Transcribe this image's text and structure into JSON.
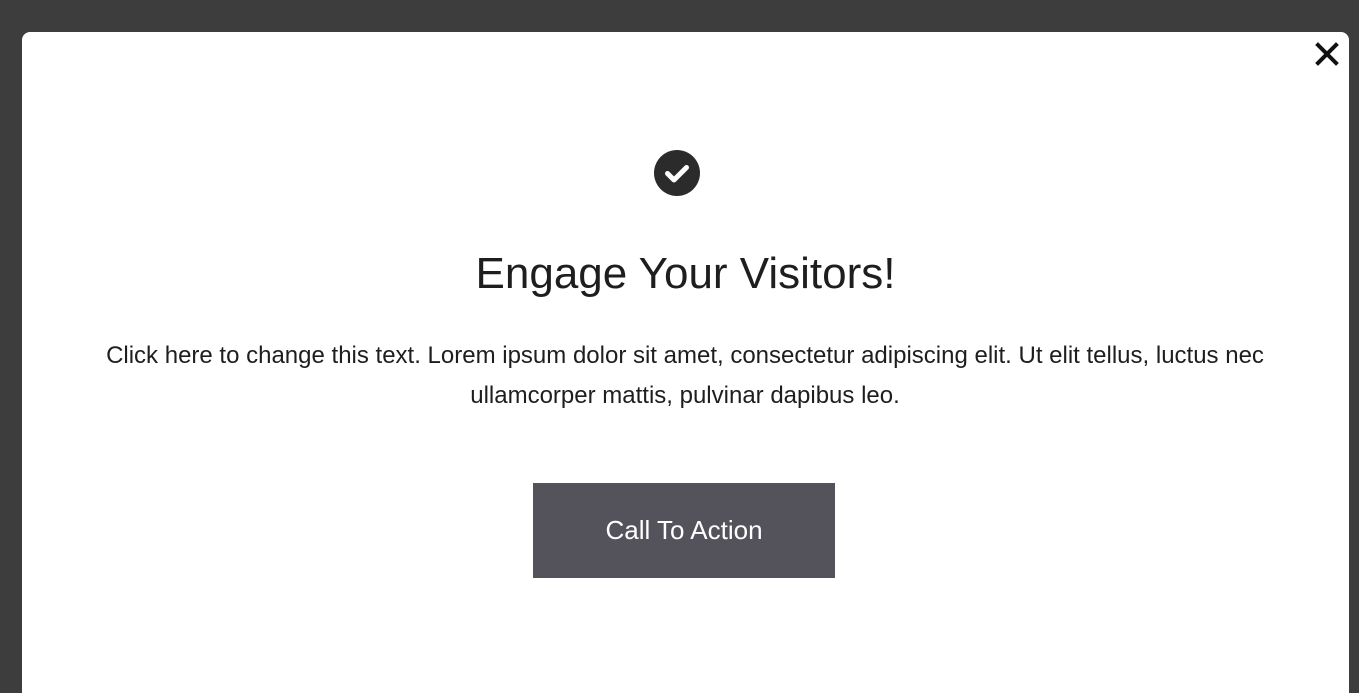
{
  "modal": {
    "close_icon": "close-icon",
    "status_icon": "check-circle-icon",
    "title": "Engage Your Visitors!",
    "body": "Click here to change this text. Lorem ipsum dolor sit amet, consectetur adipiscing elit. Ut elit tellus, luctus nec ullamcorper mattis, pulvinar dapibus leo.",
    "cta_label": "Call To Action"
  },
  "colors": {
    "overlay": "#3d3d3d",
    "modal_background": "#ffffff",
    "button_background": "#54525a",
    "button_text": "#ffffff",
    "text": "#1e1e1e",
    "icon": "#2b2b2b"
  }
}
